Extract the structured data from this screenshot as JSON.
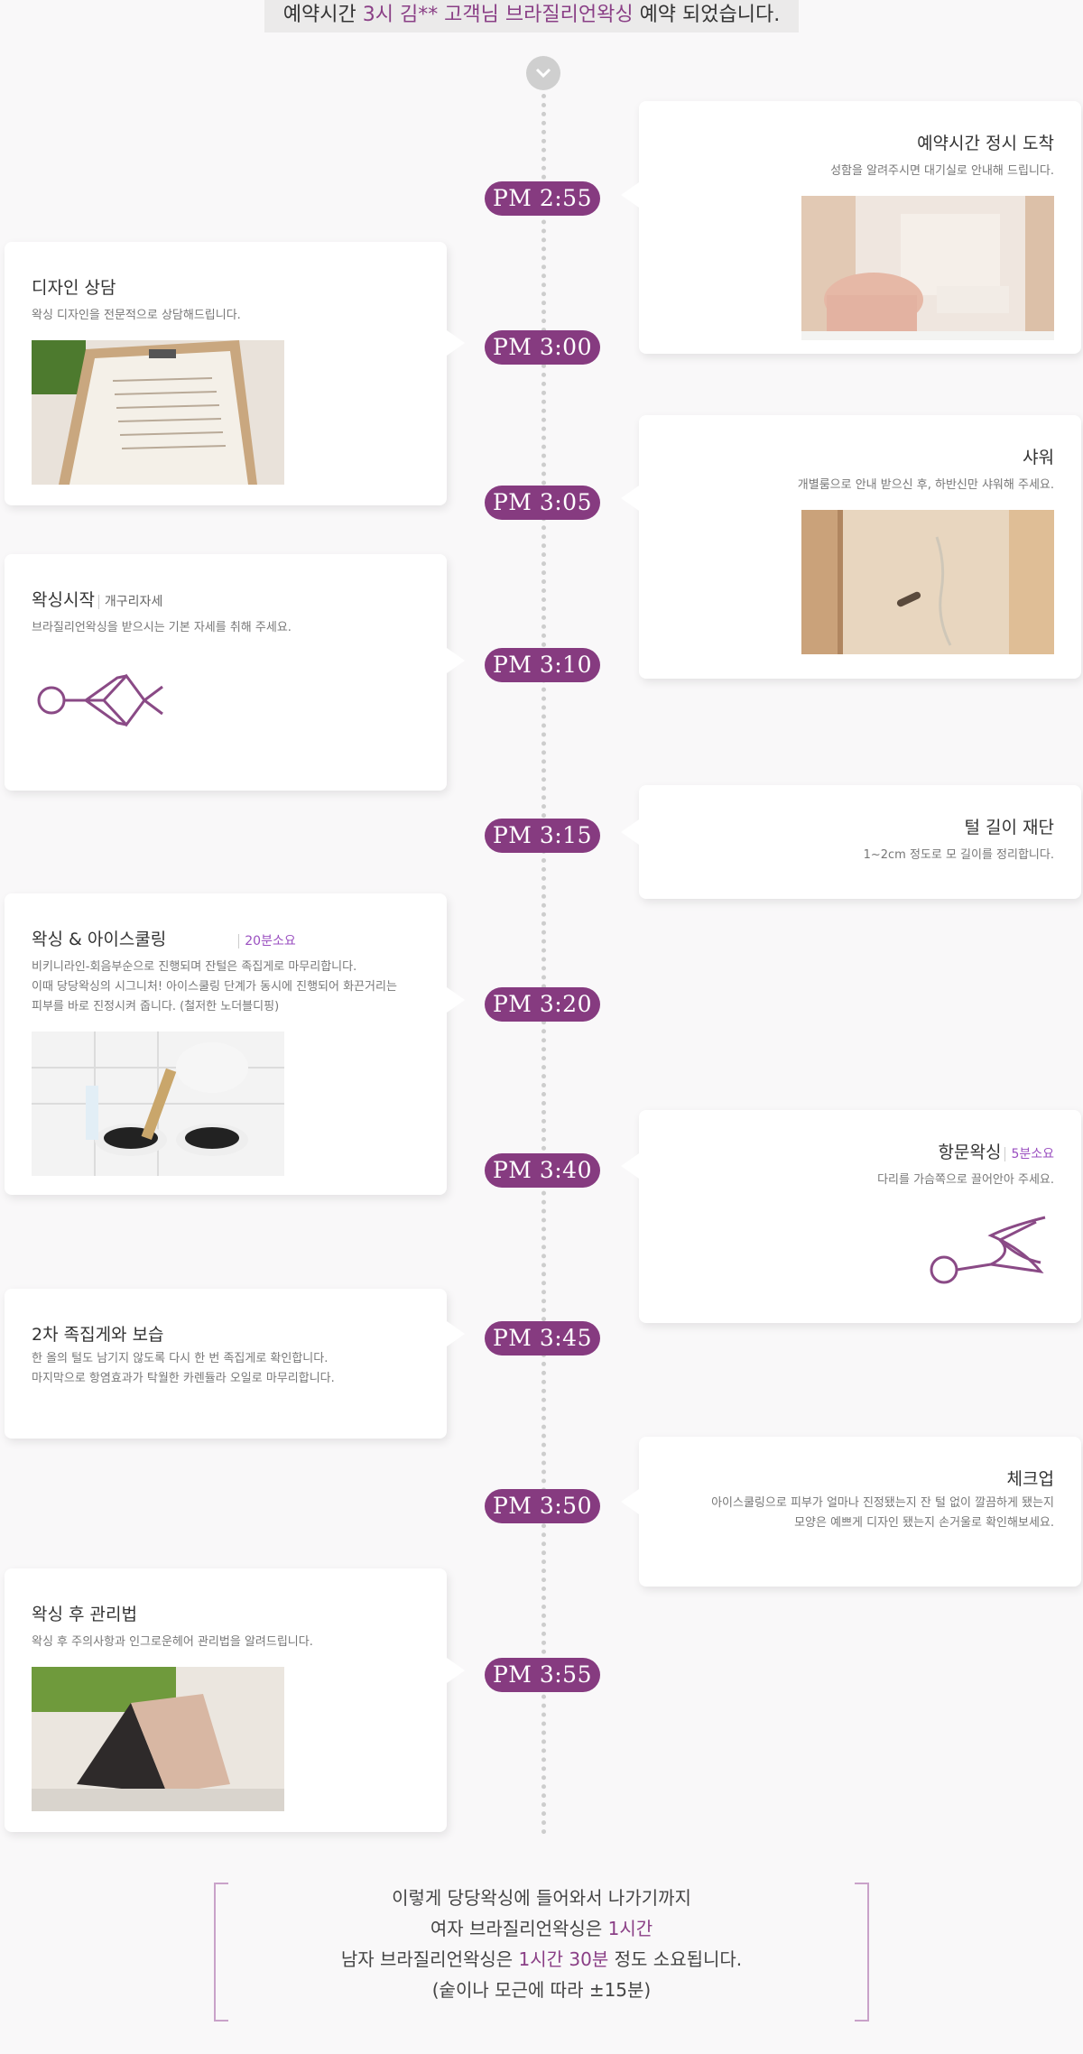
{
  "banner": {
    "pre": "예약시간 ",
    "highlight": "3시 김** 고객님 브라질리언왁싱",
    "post": " 예약 되었습니다."
  },
  "timeline": [
    {
      "time": "PM 2:55",
      "side": "right",
      "title": "예약시간 정시 도착",
      "tag": "",
      "sub": "성함을 알려주시면 대기실로 안내해 드립니다.",
      "media": "reception-photo"
    },
    {
      "time": "PM 3:00",
      "side": "left",
      "title": "디자인 상담",
      "tag": "",
      "sub": "왁싱 디자인을 전문적으로 상담해드립니다.",
      "media": "clipboard-photo"
    },
    {
      "time": "PM 3:05",
      "side": "right",
      "title": "샤워",
      "tag": "",
      "sub": "개별룸으로 안내 받으신 후, 하반신만 샤워해 주세요.",
      "media": "shower-photo"
    },
    {
      "time": "PM 3:10",
      "side": "left",
      "title": "왁싱시작",
      "tag": "개구리자세",
      "sub": "브라질리언왁싱을 받으시는 기본 자세를 취해 주세요.",
      "media": "frog-pose-icon"
    },
    {
      "time": "PM 3:15",
      "side": "right",
      "title": "털 길이 재단",
      "tag": "",
      "sub": "1~2cm 정도로 모 길이를 정리합니다.",
      "media": ""
    },
    {
      "time": "PM 3:20",
      "side": "left",
      "title": "왁싱 & 아이스쿨링",
      "tag": "20분소요",
      "sub": "비키니라인-회음부순으로 진행되며 잔털은 족집게로 마무리합니다.\n이때 당당왁싱의 시그니처! 아이스쿨링 단계가 동시에 진행되어 화끈거리는\n피부를 바로 진정시켜 줍니다. (철저한 노더블디핑)",
      "media": "wax-pot-photo"
    },
    {
      "time": "PM 3:40",
      "side": "right",
      "title": "항문왁싱",
      "tag": "5분소요",
      "sub": "다리를 가슴쪽으로 끌어안아 주세요.",
      "media": "knee-hug-pose-icon"
    },
    {
      "time": "PM 3:45",
      "side": "left",
      "title": "2차 족집게와 보습",
      "tag": "",
      "sub": "한 올의 털도 남기지 않도록 다시 한 번 족집게로 확인합니다.\n마지막으로 항염효과가 탁월한 카렌듈라 오일로 마무리합니다.",
      "media": ""
    },
    {
      "time": "PM 3:50",
      "side": "right",
      "title": "체크업",
      "tag": "",
      "sub": "아이스쿨링으로 피부가 얼마나 진정됐는지 잔 털 없이 깔끔하게 됐는지\n모양은 예쁘게 디자인 됐는지 손거울로 확인해보세요.",
      "media": ""
    },
    {
      "time": "PM 3:55",
      "side": "left",
      "title": "왁싱 후 관리법",
      "tag": "",
      "sub": "왁싱 후 주의사항과 인그로운헤어 관리법을 알려드립니다.",
      "media": "care-card-photo"
    }
  ],
  "footer": {
    "line1": "이렇게 당당왁싱에 들어와서 나가기까지",
    "line2_pre": "여자 브라질리언왁싱은 ",
    "line2_hl": "1시간",
    "line3_pre": "남자 브라질리언왁싱은 ",
    "line3_hl": "1시간 30분",
    "line3_post": " 정도 소요됩니다.",
    "line4": "(숱이나 모근에 따라 ±15분)"
  },
  "colors": {
    "accent": "#863b80",
    "pill": "#863b80",
    "tag": "#9a4fc0",
    "axis": "#cdcdcd"
  }
}
